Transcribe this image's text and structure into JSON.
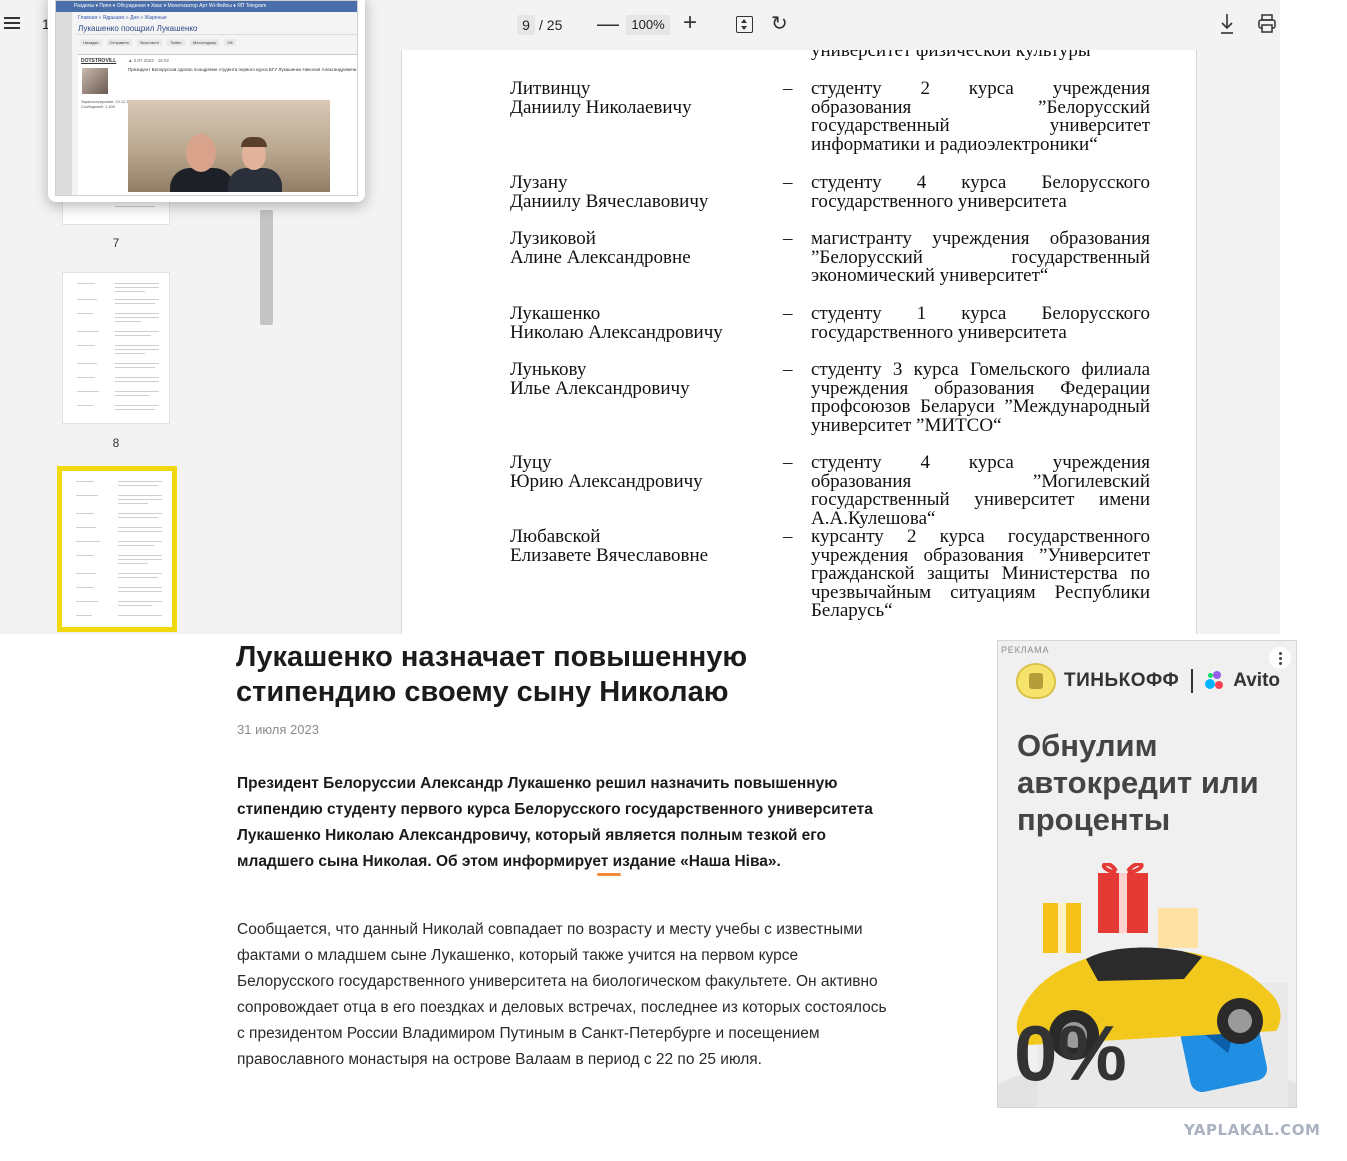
{
  "viewer": {
    "toolbar": {
      "page_indicator_left": "1",
      "current_page": "9",
      "page_separator": "/ 25",
      "zoom": "100%",
      "minus": "—",
      "plus": "+",
      "rotate": "↻"
    },
    "thumbnails": [
      {
        "label": "7"
      },
      {
        "label": "8"
      }
    ],
    "popup": {
      "nav": "Разделы ▾   Пипл ▾   Обсуждения ▾   Хвас ▾   Монетизатор   Арт   Wi-Фейсы   ♦ ЯП Telegram",
      "breadcrumb": "Главная » Ядрышко » Дно » Жареные",
      "title": "Лукашенко поощрил Лукашенко",
      "social": [
        "Нaзадки",
        "Отправить",
        "Вконтакте",
        "Twitter",
        "Мессенджер",
        "ОК"
      ],
      "username": "DOTSTROVILL",
      "date": "▲ 2.07.2022 · 16:02",
      "text": "Президент Белоруссии сделал поощрение студента первого курса БГУ Лукашенко Николая Александровича",
      "meta": "Зарегистрирован: 13.12.12\nСообщений: 1 400"
    },
    "document_page": {
      "cut_line": "университет физической культуры",
      "entries": [
        {
          "name_1": "Литвинцу",
          "name_2": "Даниилу Николаевичу",
          "dash": "–",
          "desc": "студенту 2 курса учреждения образования ”Белорусский государственный университет информатики и радиоэлектроники“"
        },
        {
          "name_1": "Лузану",
          "name_2": "Даниилу Вячеславовичу",
          "dash": "–",
          "desc": "студенту 4 курса Белорусского государственного университета"
        },
        {
          "name_1": "Лузиковой",
          "name_2": "Алине Александровне",
          "dash": "–",
          "desc": "магистранту учреждения образования ”Белорусский государственный экономический университет“"
        },
        {
          "name_1": "Лукашенко",
          "name_2": "Николаю Александровичу",
          "dash": "–",
          "desc": "студенту 1 курса Белорусского государственного университета"
        },
        {
          "name_1": "Лунькову",
          "name_2": "Илье Александровичу",
          "dash": "–",
          "desc": "студенту 3 курса Гомельского филиала учреждения образования Федерации профсоюзов Беларуси ”Международный университет ”МИТСО“"
        },
        {
          "name_1": "Луцу",
          "name_2": "Юрию Александровичу",
          "dash": "–",
          "desc": "студенту 4 курса учреждения образования ”Могилевский государственный университет имени А.А.Кулешова“"
        },
        {
          "name_1": "Любавской",
          "name_2": "Елизавете Вячеславовне",
          "dash": "–",
          "desc": "курсанту 2 курса государственного учреждения образования ”Университет гражданской защиты Министерства по чрезвычайным ситуациям Республики Беларусь“"
        }
      ]
    }
  },
  "article": {
    "title": "Лукашенко назначает повышенную стипендию своему сыну Николаю",
    "date": "31 июля 2023",
    "lead_part1": "Президент Белоруссии Александр Лукашенко решил назначить повышенную стипендию студенту первого курса Белорусского государственного университета Лукашенко Николаю Александровичу, который ",
    "lead_highlight": "является полным тезкой его младшего сына Николая",
    "lead_part2": ". Об этом информирует издание «Наша Ніва».",
    "body": "Сообщается, что данный Николай совпадает по возрасту и месту учебы с известными фактами о младшем сыне Лукашенко, который также учится на первом курсе Белорусского государственного университета на биологическом факультете. Он активно сопровождает отца в его поездках и деловых встречах, последнее из которых состоялось с президентом России Владимиром Путиным в Санкт-Петербурге и посещением православного монастыря на острове Валаам в период с 22 по 25 июля."
  },
  "ad": {
    "badge": "РЕКЛАМА",
    "brand_1": "ТИНЬКОФФ",
    "brand_2": "Avito",
    "headline": "Обнулим автокредит или проценты",
    "percent": "0%",
    "colors": {
      "car": "#f3c81c",
      "gift_red": "#e53935",
      "gift_gold": "#f6c21a",
      "blue_block": "#1f8ee3"
    }
  },
  "watermark": "YAPLAKAL.COM",
  "colors": {
    "selection_border": "#f1d90f",
    "highlight_underline": "#f08a3c"
  }
}
